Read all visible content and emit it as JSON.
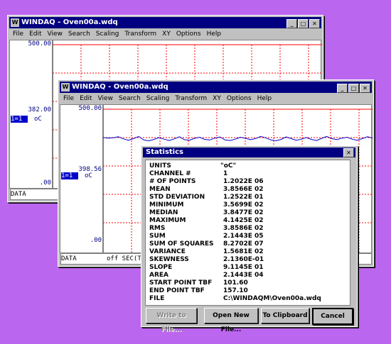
{
  "colors": {
    "desktop": "#bb66ee",
    "titlebar": "#000080",
    "grid": "#ff0000",
    "trace": "#0000cc"
  },
  "back_window": {
    "title": "WINDAQ - Oven00a.wdq",
    "menu": [
      "File",
      "Edit",
      "View",
      "Search",
      "Scaling",
      "Transform",
      "XY",
      "Options",
      "Help"
    ],
    "top_scale": "500.00",
    "value": "382.00",
    "channel": "1=1",
    "units": "oC",
    "bottom_scale": ".00",
    "status": "DATA"
  },
  "front_window": {
    "title": "WINDAQ - Oven00a.wdq",
    "menu": [
      "File",
      "Edit",
      "View",
      "Search",
      "Scaling",
      "Transform",
      "XY",
      "Options",
      "Help"
    ],
    "top_scale": "500.00",
    "value": "398.56",
    "channel": "1=1",
    "units": "oC",
    "bottom_scale": ".00",
    "status": "DATA",
    "status_right": "off SEC(TB"
  },
  "stats_dialog": {
    "title": "Statistics",
    "rows": [
      {
        "label": "UNITS",
        "value": "\"oC\""
      },
      {
        "label": "CHANNEL #",
        "value": "1"
      },
      {
        "label": "# OF POINTS",
        "value": "1.2022E 06"
      },
      {
        "label": "MEAN",
        "value": "3.8566E 02"
      },
      {
        "label": "STD DEVIATION",
        "value": "1.2522E 01"
      },
      {
        "label": "MINIMUM",
        "value": "3.5699E 02"
      },
      {
        "label": "MEDIAN",
        "value": "3.8477E 02"
      },
      {
        "label": "MAXIMUM",
        "value": "4.1425E 02"
      },
      {
        "label": "RMS",
        "value": "3.8586E 02"
      },
      {
        "label": "SUM",
        "value": "2.1443E 05"
      },
      {
        "label": "SUM OF SQUARES",
        "value": "8.2702E 07"
      },
      {
        "label": "VARIANCE",
        "value": "1.5681E 02"
      },
      {
        "label": "SKEWNESS",
        "value": "2.1360E-01"
      },
      {
        "label": "SLOPE",
        "value": "9.1145E 01"
      },
      {
        "label": "AREA",
        "value": "2.1443E 04"
      },
      {
        "label": "START POINT TBF",
        "value": "101.60"
      },
      {
        "label": "END POINT TBF",
        "value": "157.10"
      },
      {
        "label": "FILE",
        "value": "C:\\WINDAQM\\Oven00a.wdq"
      }
    ],
    "buttons": {
      "write": "Write to File...",
      "open": "Open New File...",
      "clip": "To Clipboard",
      "cancel": "Cancel"
    }
  },
  "trace": [
    395,
    393,
    394,
    398,
    390,
    385,
    391,
    399,
    386,
    383,
    388,
    395,
    389,
    384,
    390,
    398,
    387,
    385,
    392,
    396,
    388,
    386,
    393,
    397,
    386,
    384,
    389,
    396,
    392,
    387,
    391,
    399,
    394,
    386,
    383,
    388,
    397,
    391,
    385,
    389,
    395,
    388,
    384,
    392,
    399,
    391,
    387,
    393,
    396,
    389,
    385,
    391,
    398,
    393
  ]
}
